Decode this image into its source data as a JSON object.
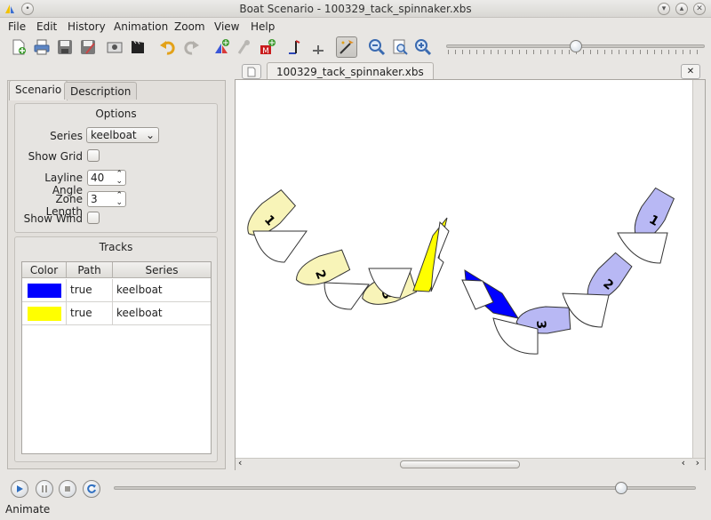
{
  "window": {
    "title": "Boat  Scenario  -  100329_tack_spinnaker.xbs"
  },
  "menu": [
    "File",
    "Edit",
    "History",
    "Animation",
    "Zoom",
    "View",
    "Help"
  ],
  "toolbar": {
    "icons": [
      "new-file-icon",
      "print-icon",
      "save-icon",
      "save-as-icon",
      "export-image-icon",
      "export-animation-icon",
      "undo-icon",
      "redo-icon",
      "add-track-icon",
      "delete-track-icon",
      "add-mark-icon",
      "add-point-icon",
      "delete-point-icon",
      "edit-mode-icon",
      "zoom-out-icon",
      "zoom-fit-icon",
      "zoom-in-icon"
    ],
    "zoom_level": 0.5
  },
  "left_tabs": [
    "Scenario",
    "Description"
  ],
  "options": {
    "title": "Options",
    "series_label": "Series",
    "series_value": "keelboat",
    "show_grid_label": "Show Grid",
    "layline_label": "Layline Angle",
    "layline_value": "40",
    "zone_label": "Zone Length",
    "zone_value": "3",
    "show_wind_label": "Show Wind"
  },
  "tracks": {
    "title": "Tracks",
    "headers": [
      "Color",
      "Path",
      "Series"
    ],
    "rows": [
      {
        "color": "#0000ff",
        "path": "true",
        "series": "keelboat"
      },
      {
        "color": "#ffff00",
        "path": "true",
        "series": "keelboat"
      }
    ]
  },
  "document": {
    "tab_label": "100329_tack_spinnaker.xbs"
  },
  "boats": [
    {
      "label": "1",
      "track": "yellow"
    },
    {
      "label": "2",
      "track": "yellow"
    },
    {
      "label": "3",
      "track": "yellow"
    },
    {
      "label": "1",
      "track": "blue"
    },
    {
      "label": "2",
      "track": "blue"
    },
    {
      "label": "3",
      "track": "blue"
    }
  ],
  "colors": {
    "blue": "#0000ff",
    "yellow": "#ffff00",
    "blue_faded": "#b8b8f4",
    "yellow_faded": "#f8f4b8"
  },
  "animation": {
    "position": 0.88,
    "status": "Animate"
  }
}
